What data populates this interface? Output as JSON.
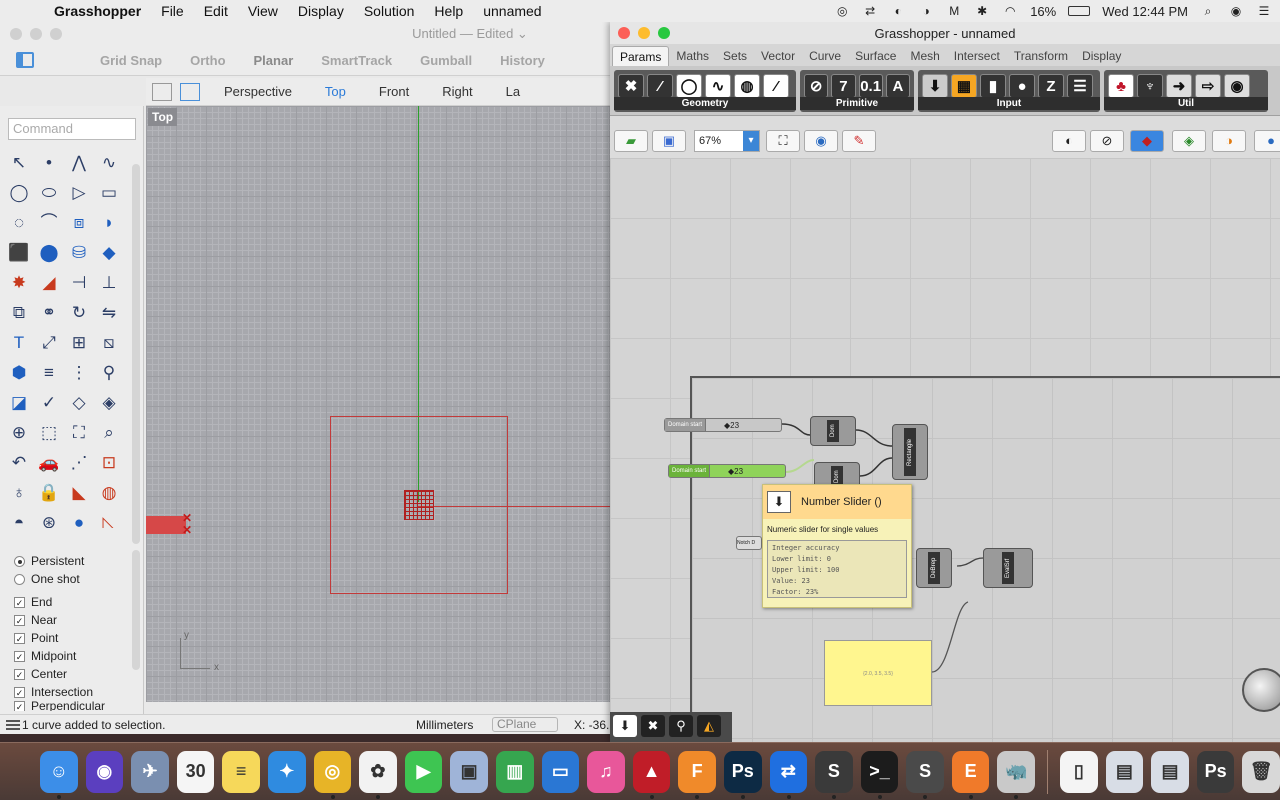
{
  "menubar": {
    "apple": "",
    "app_name": "Grasshopper",
    "items": [
      "File",
      "Edit",
      "View",
      "Display",
      "Solution",
      "Help",
      "unnamed"
    ],
    "battery": "16%",
    "clock": "Wed 12:44 PM"
  },
  "rhino": {
    "title": "Untitled — Edited ⌄",
    "modes": [
      "Grid Snap",
      "Ortho",
      "Planar",
      "SmartTrack",
      "Gumball",
      "History"
    ],
    "view_tabs": [
      "Perspective",
      "Top",
      "Front",
      "Right"
    ],
    "active_view_tab": "Top",
    "layers_clip": "La",
    "command_placeholder": "Command",
    "viewport_label": "Top",
    "cplane_y": "y",
    "cplane_x": "x",
    "osnap": {
      "persistent": "Persistent",
      "one_shot": "One shot",
      "checks": [
        "End",
        "Near",
        "Point",
        "Midpoint",
        "Center",
        "Intersection",
        "Perpendicular"
      ]
    },
    "status": {
      "message": "1 curve added to selection.",
      "units": "Millimeters",
      "cplane": "CPlane",
      "coord": "X: -36."
    }
  },
  "grasshopper": {
    "title": "Grasshopper - unnamed",
    "tabs": [
      "Params",
      "Maths",
      "Sets",
      "Vector",
      "Curve",
      "Surface",
      "Mesh",
      "Intersect",
      "Transform",
      "Display"
    ],
    "active_tab": "Params",
    "ribbon_groups": [
      "Geometry",
      "Primitive",
      "Input",
      "Util"
    ],
    "zoom": "67%",
    "slider1": {
      "name": "Domain start",
      "value": "◆23"
    },
    "slider2": {
      "name": "Domain start",
      "value": "◆23"
    },
    "notch_label": "Notch D",
    "components": {
      "dom1": "Dom",
      "dom2": "Dom",
      "rect": "Rectangle",
      "debrep": "DeBrep",
      "evalsrf": "EvalSrf"
    },
    "tooltip": {
      "title": "Number Slider ()",
      "description": "Numeric slider for single values",
      "info": [
        "Integer accuracy",
        "Lower limit: 0",
        "Upper limit: 100",
        "Value: 23",
        "Factor: 23%"
      ]
    },
    "panel_text": "{2.0, 3.5, 3.5}"
  },
  "dock": {
    "apps": [
      {
        "name": "finder",
        "color": "#3c8ee8",
        "glyph": "☺"
      },
      {
        "name": "siri",
        "color": "#5b3fbf",
        "glyph": "◉"
      },
      {
        "name": "launchpad",
        "color": "#7a8fb0",
        "glyph": "✈"
      },
      {
        "name": "calendar",
        "color": "#f5f5f5",
        "glyph": "30"
      },
      {
        "name": "notes",
        "color": "#f6d85a",
        "glyph": "≡"
      },
      {
        "name": "safari",
        "color": "#2f8be0",
        "glyph": "✦"
      },
      {
        "name": "chrome",
        "color": "#e7b427",
        "glyph": "◎"
      },
      {
        "name": "photos",
        "color": "#f2f2f2",
        "glyph": "✿"
      },
      {
        "name": "facetime",
        "color": "#3ec552",
        "glyph": "▶"
      },
      {
        "name": "preview",
        "color": "#9fb4d8",
        "glyph": "▣"
      },
      {
        "name": "numbers",
        "color": "#36a64f",
        "glyph": "▥"
      },
      {
        "name": "keynote",
        "color": "#2a77d4",
        "glyph": "▭"
      },
      {
        "name": "itunes",
        "color": "#e8579a",
        "glyph": "♫"
      },
      {
        "name": "autocad",
        "color": "#c01d28",
        "glyph": "▲"
      },
      {
        "name": "fusion360",
        "color": "#f08a2a",
        "glyph": "F"
      },
      {
        "name": "photoshop",
        "color": "#0d2a44",
        "glyph": "Ps"
      },
      {
        "name": "teamviewer",
        "color": "#1f6fe0",
        "glyph": "⇄"
      },
      {
        "name": "sublime",
        "color": "#3a3a3a",
        "glyph": "S"
      },
      {
        "name": "terminal",
        "color": "#1c1c1c",
        "glyph": ">_"
      },
      {
        "name": "sublime2",
        "color": "#4a4a4a",
        "glyph": "S"
      },
      {
        "name": "eagle",
        "color": "#f07a2a",
        "glyph": "E"
      },
      {
        "name": "rhino",
        "color": "#c9c9c9",
        "glyph": "🦏"
      },
      {
        "name": "document",
        "color": "#f4f4f4",
        "glyph": "▯"
      },
      {
        "name": "window1",
        "color": "#d8dde6",
        "glyph": "▤"
      },
      {
        "name": "window2",
        "color": "#d8dde6",
        "glyph": "▤"
      },
      {
        "name": "window3",
        "color": "#3a3a3a",
        "glyph": "Ps"
      },
      {
        "name": "trash",
        "color": "#d8d8d8",
        "glyph": "🗑"
      }
    ]
  }
}
